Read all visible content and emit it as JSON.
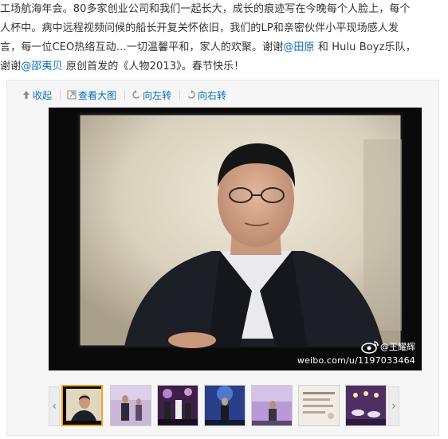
{
  "post": {
    "line1": "工场航海年会。80多家创业公司和我们一起长大，成长的痕迹写在今晚每个人脸上，每个",
    "line2": "人杯中。病中远程视频问候的船长开复关怀依旧，我们的LP和亲密伙伴小平现场感人发",
    "line3_a": "言，每一位CEO热络互动…一切温馨平和，家人的欢聚。谢谢",
    "mention1": "@田原",
    "line3_b": " 和 Hulu Boyz乐队，",
    "line4_a": "谢谢",
    "mention2": "@邵夷贝",
    "line4_b": " 原创首发的《人物2013》。春节快乐！"
  },
  "toolbar": {
    "collapse": "收起",
    "view_large": "查看大图",
    "rotate_left": "向左转",
    "rotate_right": "向右转"
  },
  "photo": {
    "watermark_name": "@王耀辉",
    "watermark_url": "weibo.com/u/1197033464"
  },
  "thumbnails": {
    "count": 7,
    "active_index": 0
  },
  "colors": {
    "link": "#0a6cb5",
    "active_thumb_border": "#f2a31a",
    "text": "#333333"
  }
}
